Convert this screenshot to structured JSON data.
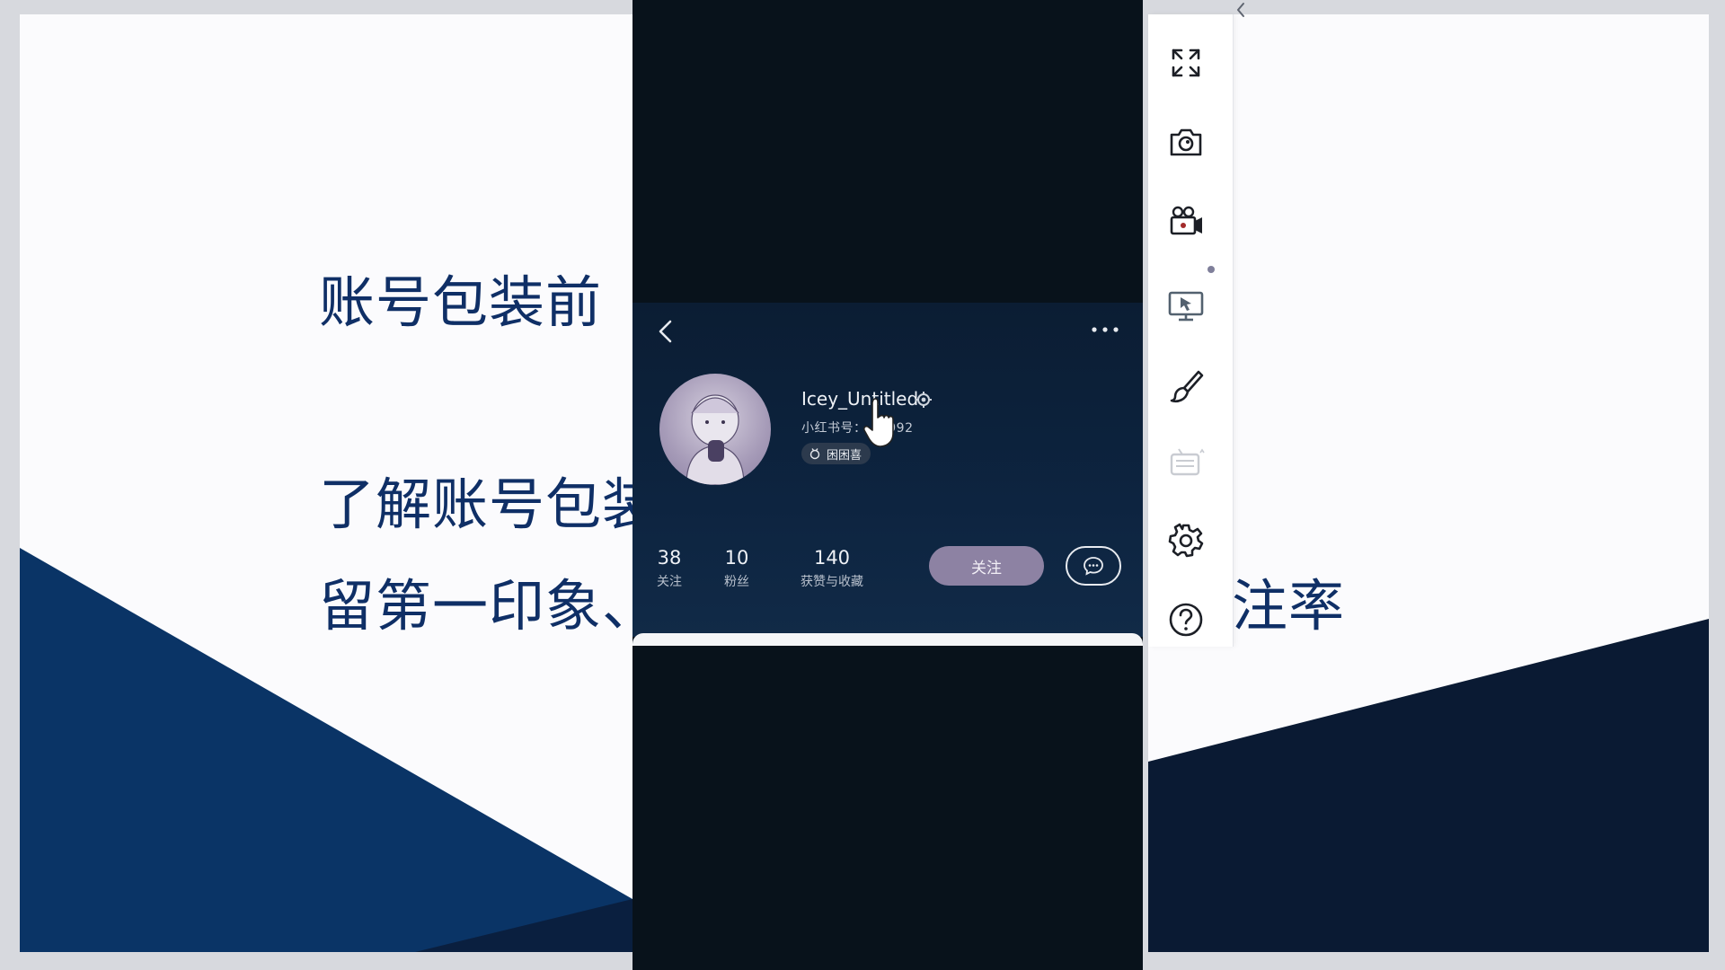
{
  "slide": {
    "title": "账号包装前",
    "body_line1": "了解账号包装",
    "body_line2": "留第一印象、",
    "body_right": "注率",
    "colors": {
      "navy": "#0f2f66",
      "accent": "#0a3466",
      "dark": "#0a1a33"
    }
  },
  "profile": {
    "username": "Icey_Untitled",
    "redbook_id": "小红书号：    08992",
    "tag_label": "困困喜",
    "stats": [
      {
        "value": "38",
        "label": "关注"
      },
      {
        "value": "10",
        "label": "粉丝"
      },
      {
        "value": "140",
        "label": "获赞与收藏"
      }
    ],
    "follow_label": "关注",
    "icons": {
      "back": "chevron-left-icon",
      "more": "more-dots-icon",
      "message": "chat-bubble-icon",
      "verified": "gear-badge-icon"
    }
  },
  "toolbar": {
    "tools": [
      {
        "name": "fullscreen",
        "icon": "expand-icon"
      },
      {
        "name": "screenshot",
        "icon": "camera-icon"
      },
      {
        "name": "record",
        "icon": "video-camera-icon"
      },
      {
        "name": "screen-share",
        "icon": "monitor-cursor-icon"
      },
      {
        "name": "brush",
        "icon": "brush-icon"
      },
      {
        "name": "keyboard",
        "icon": "keyboard-icon",
        "disabled": true
      },
      {
        "name": "settings",
        "icon": "gear-icon"
      },
      {
        "name": "help",
        "icon": "help-icon"
      }
    ],
    "collapse_icon": "chevron-left-icon"
  }
}
